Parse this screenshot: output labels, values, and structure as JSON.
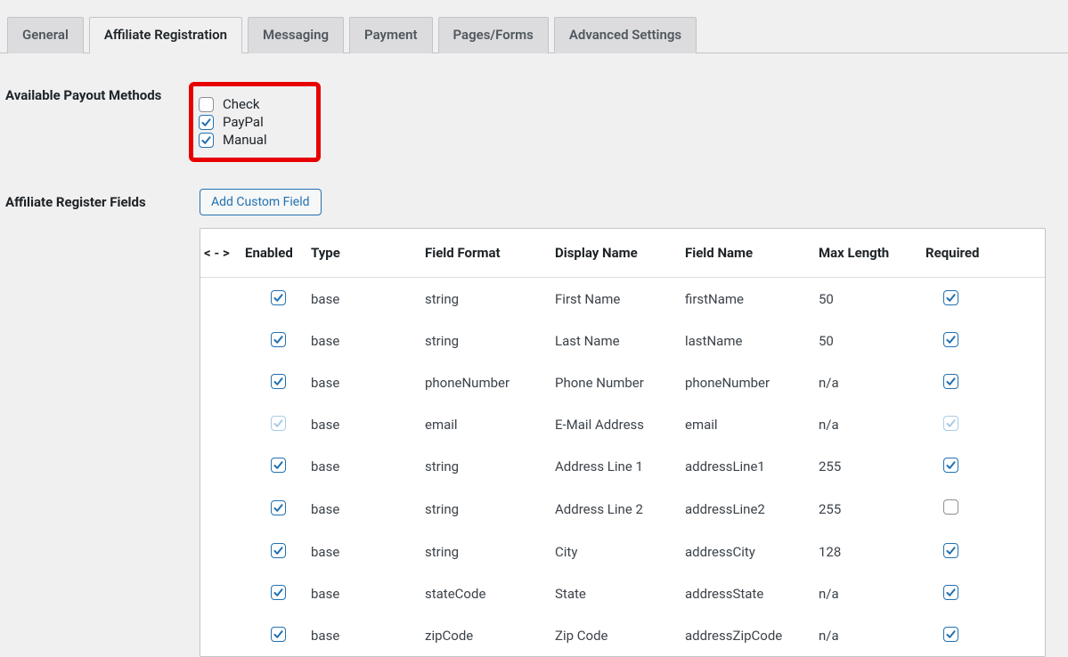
{
  "tabs": {
    "general": "General",
    "affiliate_registration": "Affiliate Registration",
    "messaging": "Messaging",
    "payment": "Payment",
    "pages_forms": "Pages/Forms",
    "advanced_settings": "Advanced Settings"
  },
  "labels": {
    "available_payout_methods": "Available Payout Methods",
    "affiliate_register_fields": "Affiliate Register Fields",
    "add_custom_field": "Add Custom Field"
  },
  "payout_methods": {
    "check": {
      "label": "Check",
      "checked": false
    },
    "paypal": {
      "label": "PayPal",
      "checked": true
    },
    "manual": {
      "label": "Manual",
      "checked": true
    }
  },
  "table": {
    "headers": {
      "drag": "< - >",
      "enabled": "Enabled",
      "type": "Type",
      "field_format": "Field Format",
      "display_name": "Display Name",
      "field_name": "Field Name",
      "max_length": "Max Length",
      "required": "Required"
    },
    "rows": [
      {
        "enabled": true,
        "enabled_faded": false,
        "type": "base",
        "field_format": "string",
        "display_name": "First Name",
        "field_name": "firstName",
        "max_length": "50",
        "required": true,
        "required_faded": false
      },
      {
        "enabled": true,
        "enabled_faded": false,
        "type": "base",
        "field_format": "string",
        "display_name": "Last Name",
        "field_name": "lastName",
        "max_length": "50",
        "required": true,
        "required_faded": false
      },
      {
        "enabled": true,
        "enabled_faded": false,
        "type": "base",
        "field_format": "phoneNumber",
        "display_name": "Phone Number",
        "field_name": "phoneNumber",
        "max_length": "n/a",
        "required": true,
        "required_faded": false
      },
      {
        "enabled": true,
        "enabled_faded": true,
        "type": "base",
        "field_format": "email",
        "display_name": "E-Mail Address",
        "field_name": "email",
        "max_length": "n/a",
        "required": true,
        "required_faded": true
      },
      {
        "enabled": true,
        "enabled_faded": false,
        "type": "base",
        "field_format": "string",
        "display_name": "Address Line 1",
        "field_name": "addressLine1",
        "max_length": "255",
        "required": true,
        "required_faded": false
      },
      {
        "enabled": true,
        "enabled_faded": false,
        "type": "base",
        "field_format": "string",
        "display_name": "Address Line 2",
        "field_name": "addressLine2",
        "max_length": "255",
        "required": false,
        "required_faded": false
      },
      {
        "enabled": true,
        "enabled_faded": false,
        "type": "base",
        "field_format": "string",
        "display_name": "City",
        "field_name": "addressCity",
        "max_length": "128",
        "required": true,
        "required_faded": false
      },
      {
        "enabled": true,
        "enabled_faded": false,
        "type": "base",
        "field_format": "stateCode",
        "display_name": "State",
        "field_name": "addressState",
        "max_length": "n/a",
        "required": true,
        "required_faded": false
      },
      {
        "enabled": true,
        "enabled_faded": false,
        "type": "base",
        "field_format": "zipCode",
        "display_name": "Zip Code",
        "field_name": "addressZipCode",
        "max_length": "n/a",
        "required": true,
        "required_faded": false
      }
    ]
  }
}
